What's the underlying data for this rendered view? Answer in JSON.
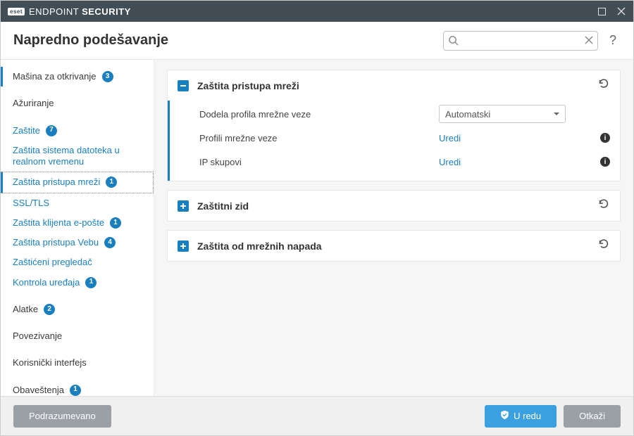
{
  "titlebar": {
    "brand_badge": "eset",
    "brand_text_light": "ENDPOINT ",
    "brand_text_bold": "SECURITY"
  },
  "header": {
    "title": "Napredno podešavanje",
    "search_placeholder": ""
  },
  "sidebar": {
    "items": [
      {
        "label": "Mašina za otkrivanje",
        "badge": "3",
        "blue": false,
        "sub": false
      },
      {
        "label": "Ažuriranje",
        "badge": "",
        "blue": false,
        "sub": false
      },
      {
        "label": "Zaštite",
        "badge": "7",
        "blue": true,
        "sub": false
      },
      {
        "label": "Zaštita sistema datoteka u realnom vremenu",
        "badge": "",
        "blue": true,
        "sub": true
      },
      {
        "label": "Zaštita pristupa mreži",
        "badge": "1",
        "blue": true,
        "sub": true,
        "selected": true
      },
      {
        "label": "SSL/TLS",
        "badge": "",
        "blue": true,
        "sub": true
      },
      {
        "label": "Zaštita klijenta e-pošte",
        "badge": "1",
        "blue": true,
        "sub": true
      },
      {
        "label": "Zaštita pristupa Vebu",
        "badge": "4",
        "blue": true,
        "sub": true
      },
      {
        "label": "Zaštićeni pregledač",
        "badge": "",
        "blue": true,
        "sub": true
      },
      {
        "label": "Kontrola uređaja",
        "badge": "1",
        "blue": true,
        "sub": true
      },
      {
        "label": "Alatke",
        "badge": "2",
        "blue": false,
        "sub": false
      },
      {
        "label": "Povezivanje",
        "badge": "",
        "blue": false,
        "sub": false
      },
      {
        "label": "Korisnički interfejs",
        "badge": "",
        "blue": false,
        "sub": false
      },
      {
        "label": "Obaveštenja",
        "badge": "1",
        "blue": false,
        "sub": false
      }
    ]
  },
  "panels": {
    "network_access": {
      "title": "Zaštita pristupa mreži",
      "rows": {
        "profile_assign": {
          "label": "Dodela profila mrežne veze",
          "select_value": "Automatski"
        },
        "profiles": {
          "label": "Profili mrežne veze",
          "link": "Uredi"
        },
        "ip_sets": {
          "label": "IP skupovi",
          "link": "Uredi"
        }
      }
    },
    "firewall": {
      "title": "Zaštitni zid"
    },
    "attack_protection": {
      "title": "Zaštita od mrežnih napada"
    }
  },
  "footer": {
    "default_btn": "Podrazumevano",
    "ok_btn": "U redu",
    "cancel_btn": "Otkaži"
  }
}
